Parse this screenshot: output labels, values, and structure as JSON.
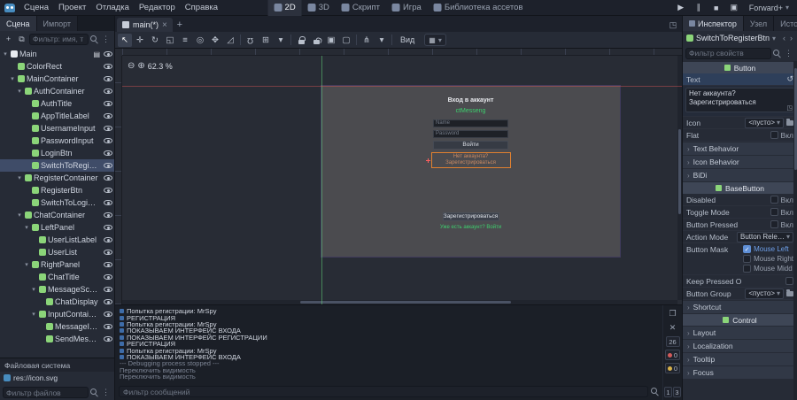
{
  "menubar": {
    "menus": [
      "Сцена",
      "Проект",
      "Отладка",
      "Редактор",
      "Справка"
    ],
    "workspaces": [
      "2D",
      "3D",
      "Скрипт",
      "Игра",
      "Библиотека ассетов"
    ],
    "renderer": "Forward+"
  },
  "left_dock": {
    "tabs": [
      "Сцена",
      "Импорт"
    ],
    "filter_placeholder": "Фильтр: имя, т",
    "scene_tree": [
      {
        "name": "Main",
        "depth": 0,
        "children": true,
        "icon_color": "#e8ebf0",
        "has_script": true
      },
      {
        "name": "ColorRect",
        "depth": 1,
        "children": false,
        "icon_color": "#8bd579"
      },
      {
        "name": "MainContainer",
        "depth": 1,
        "children": true,
        "icon_color": "#8bd579"
      },
      {
        "name": "AuthContainer",
        "depth": 2,
        "children": true,
        "icon_color": "#8bd579"
      },
      {
        "name": "AuthTitle",
        "depth": 3,
        "children": false,
        "icon_color": "#8bd579"
      },
      {
        "name": "AppTitleLabel",
        "depth": 3,
        "children": false,
        "icon_color": "#8bd579"
      },
      {
        "name": "UsernameInput",
        "depth": 3,
        "children": false,
        "icon_color": "#8bd579"
      },
      {
        "name": "PasswordInput",
        "depth": 3,
        "children": false,
        "icon_color": "#8bd579"
      },
      {
        "name": "LoginBtn",
        "depth": 3,
        "children": false,
        "icon_color": "#8bd579"
      },
      {
        "name": "SwitchToRegisterBtn",
        "depth": 3,
        "children": false,
        "icon_color": "#8bd579",
        "selected": true
      },
      {
        "name": "RegisterContainer",
        "depth": 2,
        "children": true,
        "icon_color": "#8bd579"
      },
      {
        "name": "RegisterBtn",
        "depth": 3,
        "children": false,
        "icon_color": "#8bd579"
      },
      {
        "name": "SwitchToLoginBtn",
        "depth": 3,
        "children": false,
        "icon_color": "#8bd579"
      },
      {
        "name": "ChatContainer",
        "depth": 2,
        "children": true,
        "icon_color": "#8bd579"
      },
      {
        "name": "LeftPanel",
        "depth": 3,
        "children": true,
        "icon_color": "#8bd579"
      },
      {
        "name": "UserListLabel",
        "depth": 4,
        "children": false,
        "icon_color": "#8bd579"
      },
      {
        "name": "UserList",
        "depth": 4,
        "children": false,
        "icon_color": "#8bd579"
      },
      {
        "name": "RightPanel",
        "depth": 3,
        "children": true,
        "icon_color": "#8bd579"
      },
      {
        "name": "ChatTitle",
        "depth": 4,
        "children": false,
        "icon_color": "#8bd579"
      },
      {
        "name": "MessageScroll",
        "depth": 4,
        "children": true,
        "icon_color": "#8bd579"
      },
      {
        "name": "ChatDisplay",
        "depth": 5,
        "children": false,
        "icon_color": "#8bd579"
      },
      {
        "name": "InputContainer",
        "depth": 4,
        "children": true,
        "icon_color": "#8bd579"
      },
      {
        "name": "MessageInput",
        "depth": 5,
        "children": false,
        "icon_color": "#8bd579"
      },
      {
        "name": "SendMessageBtn",
        "depth": 5,
        "children": false,
        "icon_color": "#8bd579"
      }
    ],
    "filesystem": {
      "title": "Файловая система",
      "file": "res://icon.svg",
      "filter_placeholder": "Фильтр файлов"
    }
  },
  "center": {
    "scene_tab": "main(*)",
    "view_menu": "Вид",
    "zoom": "62.3 %",
    "game_ui": {
      "login_title": "Вход в аккаунт",
      "app_title": "ctMesseng",
      "username_placeholder": "Name",
      "password_placeholder": "Password",
      "login_button": "Войти",
      "switch_to_register": "Нет аккаунта? Зарегистрироваться",
      "register_button": "Зарегистрироваться",
      "switch_to_login": "Уже есть аккаунт? Войти",
      "accent_green": "#3ecf6e",
      "selection_orange": "#e08030"
    },
    "console": {
      "lines": [
        {
          "text": "Попытка регистрации: MrSpy",
          "type": "print"
        },
        {
          "text": "РЕГИСТРАЦИЯ",
          "type": "print"
        },
        {
          "text": "Попытка регистрации: MrSpy",
          "type": "print"
        },
        {
          "text": "ПОКАЗЫВАЕМ ИНТЕРФЕЙС ВХОДА",
          "type": "print"
        },
        {
          "text": "ПОКАЗЫВАЕМ ИНТЕРФЕЙС РЕГИСТРАЦИИ",
          "type": "print"
        },
        {
          "text": "РЕГИСТРАЦИЯ",
          "type": "print"
        },
        {
          "text": "Попытка регистрации: MrSpy",
          "type": "print"
        },
        {
          "text": "ПОКАЗЫВАЕМ ИНТЕРФЕЙС ВХОДА",
          "type": "print"
        },
        {
          "text": "--- Debugging process stopped ---",
          "type": "system"
        },
        {
          "text": "Переключить видимость",
          "type": "system"
        },
        {
          "text": "Переключить видимость",
          "type": "system"
        }
      ],
      "filter_placeholder": "Фильтр сообщений",
      "badges": {
        "messages": "26",
        "errors": "0",
        "warnings": "0",
        "extra1": "1",
        "extra2": "3"
      }
    }
  },
  "right_dock": {
    "tabs": [
      "Инспектор",
      "Узел",
      "История"
    ],
    "node_name": "SwitchToRegisterBtn",
    "filter_placeholder": "Фильтр свойств",
    "button_section": {
      "title": "Button",
      "text_label": "Text",
      "text_value": "Нет аккаунта?\nЗарегистрироваться",
      "icon_label": "Icon",
      "icon_value": "<пусто>",
      "flat_label": "Flat",
      "flat_on": "Вкл",
      "groups": [
        "Text Behavior",
        "Icon Behavior",
        "BiDi"
      ]
    },
    "basebutton_section": {
      "title": "BaseButton",
      "rows": [
        {
          "label": "Disabled",
          "value": "Вкл"
        },
        {
          "label": "Toggle Mode",
          "value": "Вкл"
        },
        {
          "label": "Button Pressed",
          "value": "Вкл"
        }
      ],
      "action_mode_label": "Action Mode",
      "action_mode_value": "Button Releas",
      "button_mask_label": "Button Mask",
      "mask_options": [
        {
          "label": "Mouse Left",
          "checked": true
        },
        {
          "label": "Mouse Right",
          "checked": false
        },
        {
          "label": "Mouse Midd",
          "checked": false
        }
      ],
      "keep_pressed_label": "Keep Pressed O",
      "button_group_label": "Button Group",
      "button_group_value": "<пусто>",
      "groups": [
        "Shortcut"
      ]
    },
    "control_section": {
      "title": "Control",
      "groups": [
        "Layout",
        "Localization",
        "Tooltip",
        "Focus"
      ]
    }
  }
}
